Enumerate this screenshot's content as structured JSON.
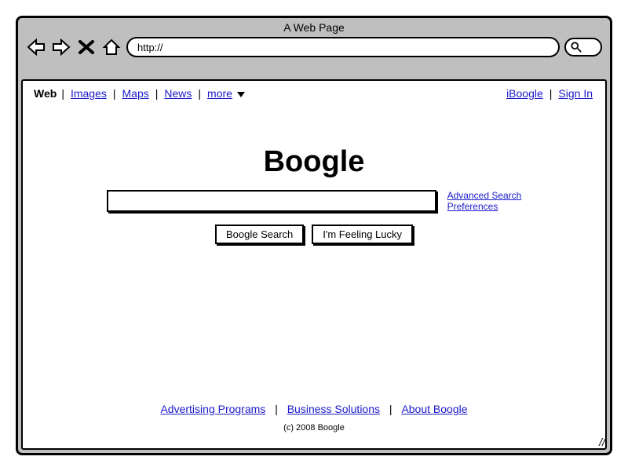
{
  "window": {
    "title": "A Web Page",
    "url": "http://"
  },
  "nav": {
    "left": {
      "current": "Web",
      "items": [
        "Images",
        "Maps",
        "News"
      ],
      "more": "more"
    },
    "right": {
      "iboogle": "iBoogle",
      "signin": "Sign In"
    }
  },
  "main": {
    "logo": "Boogle",
    "advanced": "Advanced Search",
    "prefs": "Preferences",
    "search_btn": "Boogle Search",
    "lucky_btn": "I'm Feeling Lucky"
  },
  "footer": {
    "links": [
      "Advertising Programs",
      "Business Solutions",
      "About Boogle"
    ],
    "copyright": "(c) 2008 Boogle"
  }
}
